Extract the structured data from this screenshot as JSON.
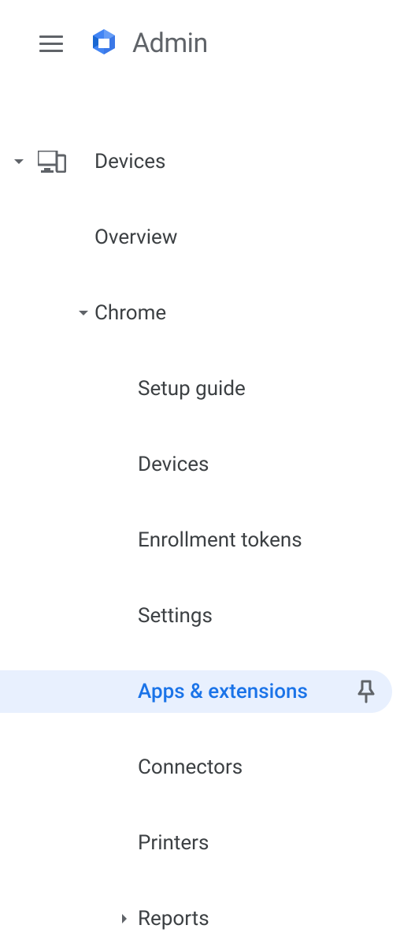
{
  "header": {
    "title": "Admin"
  },
  "nav": {
    "devices": {
      "label": "Devices",
      "children": {
        "overview": {
          "label": "Overview"
        },
        "chrome": {
          "label": "Chrome",
          "children": {
            "setup_guide": {
              "label": "Setup guide"
            },
            "devices": {
              "label": "Devices"
            },
            "enrollment_tokens": {
              "label": "Enrollment tokens"
            },
            "settings": {
              "label": "Settings"
            },
            "apps_extensions": {
              "label": "Apps & extensions"
            },
            "connectors": {
              "label": "Connectors"
            },
            "printers": {
              "label": "Printers"
            },
            "reports": {
              "label": "Reports"
            }
          }
        }
      }
    }
  }
}
